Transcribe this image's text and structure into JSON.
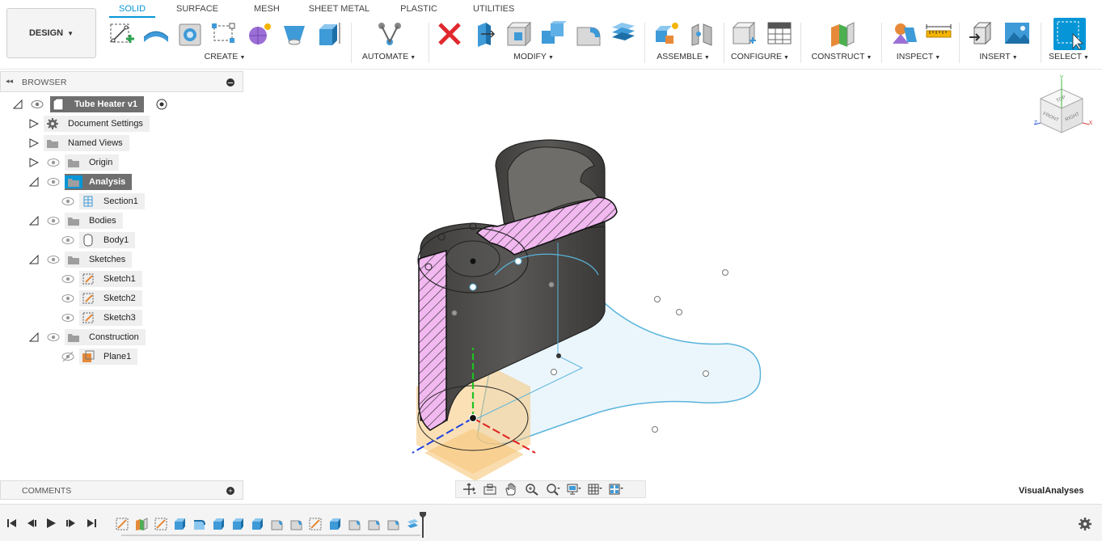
{
  "toolbar": {
    "workspace_button": "DESIGN",
    "tabs": [
      "SOLID",
      "SURFACE",
      "MESH",
      "SHEET METAL",
      "PLASTIC",
      "UTILITIES"
    ],
    "groups": [
      "CREATE",
      "AUTOMATE",
      "MODIFY",
      "ASSEMBLE",
      "CONFIGURE",
      "CONSTRUCT",
      "INSPECT",
      "INSERT",
      "SELECT"
    ]
  },
  "browser": {
    "title": "BROWSER",
    "nodes": [
      {
        "label": "Tube Heater v1"
      },
      {
        "label": "Document Settings"
      },
      {
        "label": "Named Views"
      },
      {
        "label": "Origin"
      },
      {
        "label": "Analysis"
      },
      {
        "label": "Section1"
      },
      {
        "label": "Bodies"
      },
      {
        "label": "Body1"
      },
      {
        "label": "Sketches"
      },
      {
        "label": "Sketch1"
      },
      {
        "label": "Sketch2"
      },
      {
        "label": "Sketch3"
      },
      {
        "label": "Construction"
      },
      {
        "label": "Plane1"
      }
    ]
  },
  "comments": {
    "title": "COMMENTS"
  },
  "viewport": {
    "status_label": "VisualAnalyses",
    "viewcube_faces": [
      "TOP",
      "FRONT",
      "RIGHT"
    ],
    "axis_labels": [
      "Y",
      "Z",
      "X"
    ]
  },
  "colors": {
    "accent": "#0696d7",
    "section_hatch": "#f2b8f0",
    "body": "#4b4a48",
    "plane": "#f7c77a",
    "sketch": "#5ab4dc"
  }
}
